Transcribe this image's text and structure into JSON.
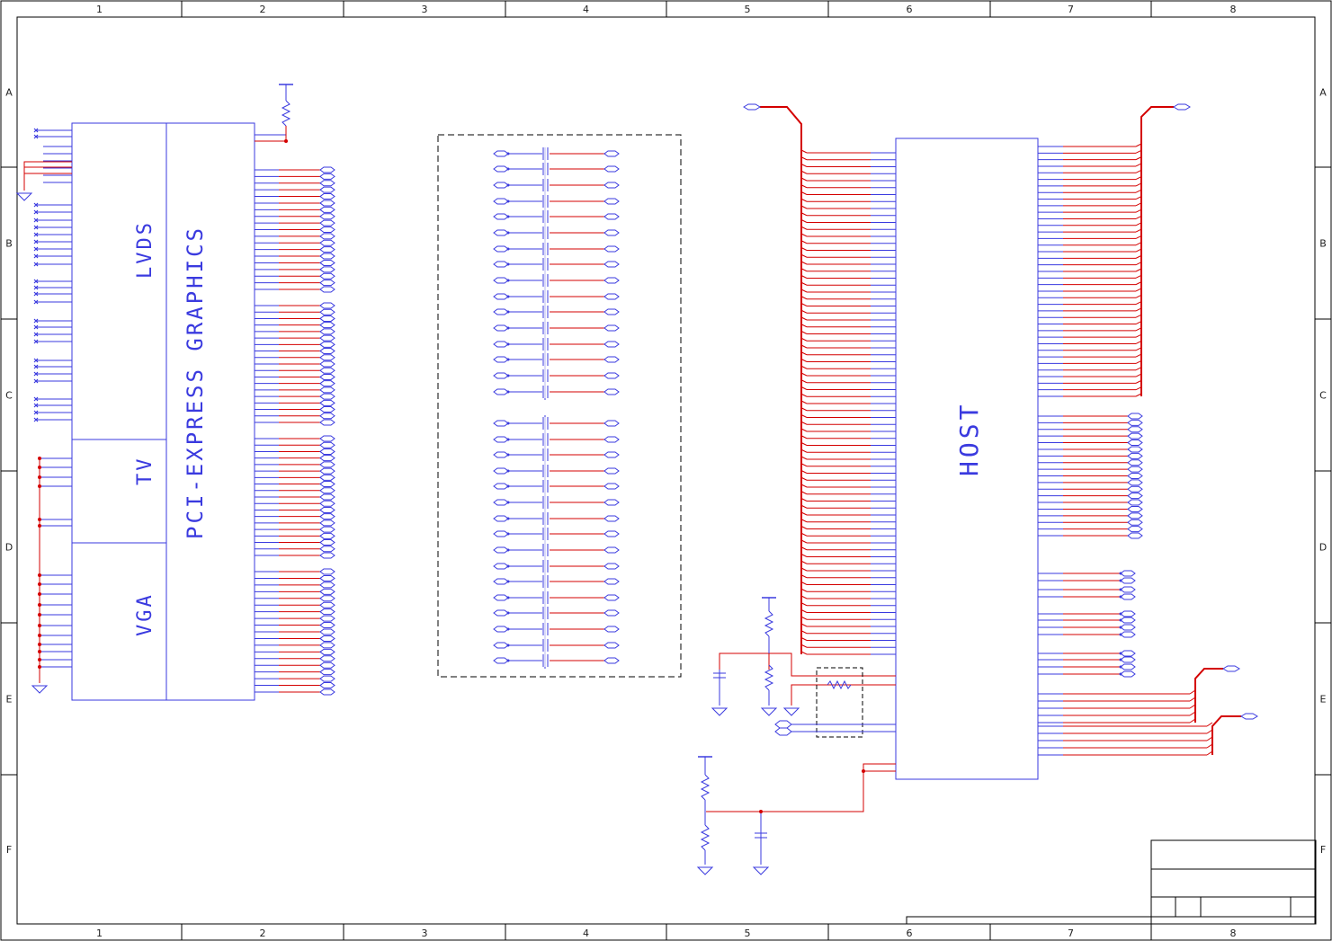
{
  "sheet": {
    "columns": [
      "1",
      "2",
      "3",
      "4",
      "5",
      "6",
      "7",
      "8"
    ],
    "rows": [
      "A",
      "B",
      "C",
      "D",
      "E",
      "F"
    ]
  },
  "blocks": {
    "lvds": "LVDS",
    "tv": "TV",
    "vga": "VGA",
    "pcie": "PCI-EXPRESS GRAPHICS",
    "host": "HOST"
  },
  "colors": {
    "wire": "#d40000",
    "component": "#3a3adf",
    "frame": "#000000"
  },
  "icons": [
    "ground-icon",
    "power-rail-icon",
    "resistor-icon",
    "capacitor-icon",
    "no-connect-icon",
    "off-page-connector-icon"
  ]
}
